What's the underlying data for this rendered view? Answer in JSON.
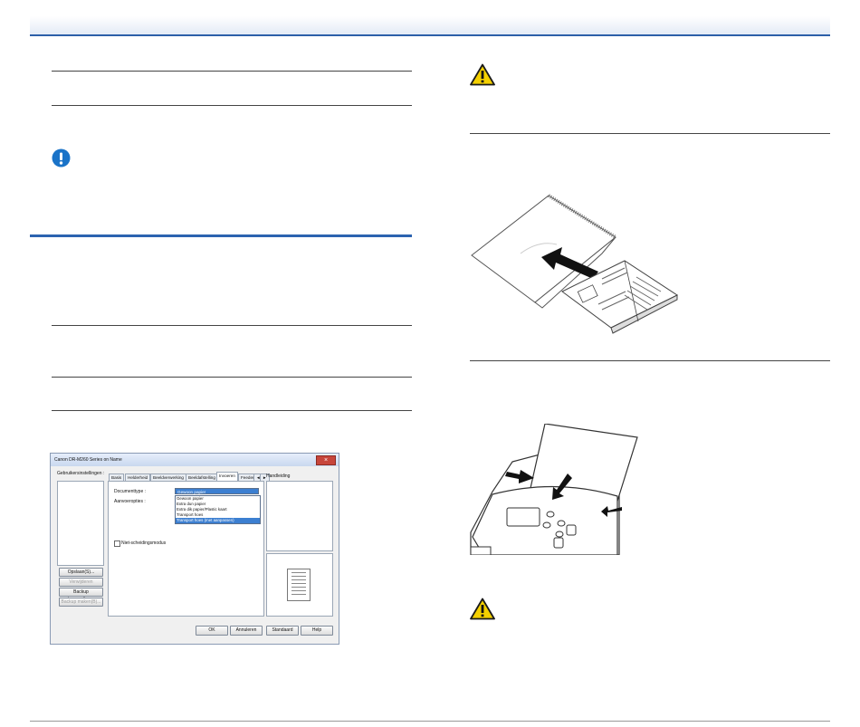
{
  "icons": {
    "warning_1": "warning-triangle-icon",
    "important": "exclamation-circle-icon",
    "warning_2": "warning-triangle-icon"
  },
  "colors": {
    "accent_blue": "#2c63b0",
    "warning_yellow": "#f4d000",
    "important_blue": "#1a73c8",
    "selection_blue": "#3c7fd1"
  },
  "dialog": {
    "title": "Canon DR-M260 Series on Name",
    "left_panel_label": "Gebruikersinstellingen :",
    "tabs": [
      "Basis",
      "Helderheid",
      "Beeldverwerking",
      "Beeldafstelling",
      "Invoeren",
      "Feeder",
      "◄",
      "►"
    ],
    "documenttype_label": "Documenttype :",
    "documenttype_value": "Gewoon papier",
    "invoeropties_label": "Aanvoeropties :",
    "dropdown_options": [
      "Gewoon papier",
      "Extra dun papier",
      "Extra dik papier/Plastic kaart",
      "Transport hoes",
      "Transport hoes (met aanpassen)"
    ],
    "checkbox_label": "Niet-scheidingsmodus",
    "right_label": "Handleiding",
    "left_buttons": {
      "opslaan": "Opslaan(S)...",
      "verwijderen": "Verwijderen",
      "backup_maken": "Backup terugzetten...",
      "backup_herstellen": "Backup maken(B)..."
    },
    "bottom_buttons": {
      "ok": "OK",
      "annuleren": "Annuleren",
      "standaard": "Standaard",
      "help": "Help"
    }
  }
}
